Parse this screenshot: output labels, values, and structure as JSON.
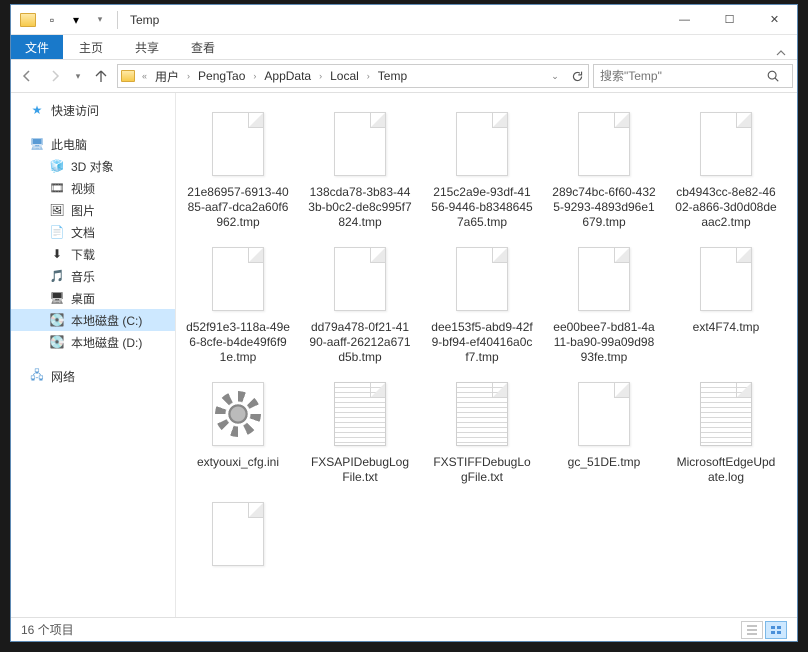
{
  "window": {
    "title": "Temp",
    "min": "—",
    "max": "☐",
    "close": "✕"
  },
  "ribbon": {
    "file": "文件",
    "tabs": [
      "主页",
      "共享",
      "查看"
    ]
  },
  "address": {
    "overflow": "«",
    "crumbs": [
      "用户",
      "PengTao",
      "AppData",
      "Local",
      "Temp"
    ]
  },
  "search": {
    "placeholder": "搜索\"Temp\""
  },
  "nav": {
    "quick": "快速访问",
    "pc": "此电脑",
    "pc_children": [
      {
        "icon": "🧊",
        "label": "3D 对象"
      },
      {
        "icon": "🎞",
        "label": "视频"
      },
      {
        "icon": "🖼",
        "label": "图片"
      },
      {
        "icon": "📄",
        "label": "文档"
      },
      {
        "icon": "⬇",
        "label": "下载"
      },
      {
        "icon": "🎵",
        "label": "音乐"
      },
      {
        "icon": "🖥",
        "label": "桌面"
      },
      {
        "icon": "💽",
        "label": "本地磁盘 (C:)"
      },
      {
        "icon": "💽",
        "label": "本地磁盘 (D:)"
      }
    ],
    "network": "网络"
  },
  "files": [
    {
      "type": "blank",
      "name": "21e86957-6913-4085-aaf7-dca2a60f6962.tmp"
    },
    {
      "type": "blank",
      "name": "138cda78-3b83-443b-b0c2-de8c995f7824.tmp"
    },
    {
      "type": "blank",
      "name": "215c2a9e-93df-4156-9446-b83486457a65.tmp"
    },
    {
      "type": "blank",
      "name": "289c74bc-6f60-4325-9293-4893d96e1679.tmp"
    },
    {
      "type": "blank",
      "name": "cb4943cc-8e82-4602-a866-3d0d08deaac2.tmp"
    },
    {
      "type": "blank",
      "name": "d52f91e3-118a-49e6-8cfe-b4de49f6f91e.tmp"
    },
    {
      "type": "blank",
      "name": "dd79a478-0f21-4190-aaff-26212a671d5b.tmp"
    },
    {
      "type": "blank",
      "name": "dee153f5-abd9-42f9-bf94-ef40416a0cf7.tmp"
    },
    {
      "type": "blank",
      "name": "ee00bee7-bd81-4a11-ba90-99a09d9893fe.tmp"
    },
    {
      "type": "blank",
      "name": "ext4F74.tmp"
    },
    {
      "type": "ini",
      "name": "extyouxi_cfg.ini"
    },
    {
      "type": "text",
      "name": "FXSAPIDebugLogFile.txt"
    },
    {
      "type": "text",
      "name": "FXSTIFFDebugLogFile.txt"
    },
    {
      "type": "blank",
      "name": "gc_51DE.tmp"
    },
    {
      "type": "text",
      "name": "MicrosoftEdgeUpdate.log"
    },
    {
      "type": "blank",
      "name": ""
    }
  ],
  "status": {
    "count": "16 个项目"
  }
}
